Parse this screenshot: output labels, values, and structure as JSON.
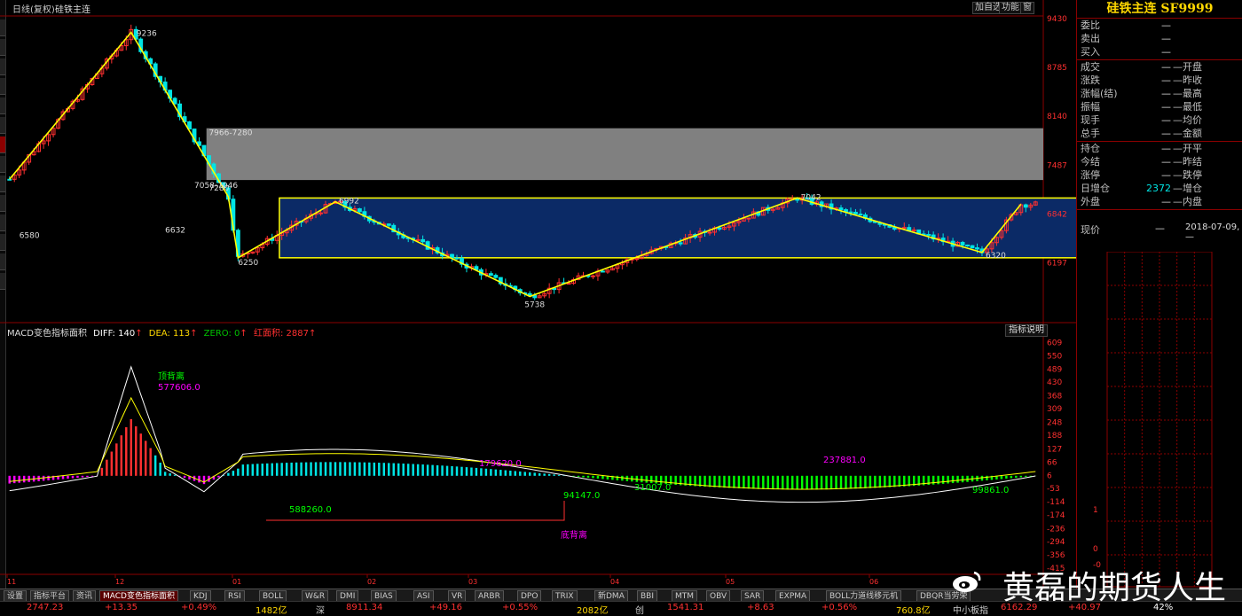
{
  "header": {
    "period": "日线(复权)",
    "name": "硅铁主连",
    "btn_add": "加自选",
    "btn_fn": "功能",
    "btn_win": "窗"
  },
  "chart_data": [
    {
      "type": "candlestick",
      "title": "硅铁主连 日线(复权)",
      "y_ticks": [
        9430,
        8785,
        8140,
        7487,
        6842,
        6197
      ],
      "x_ticks": [
        "11",
        "12",
        "01",
        "02",
        "03",
        "04",
        "05",
        "06"
      ],
      "ylim": [
        5485,
        9430
      ],
      "price_annotations": [
        "9236",
        "7966-7280",
        "7280",
        "7058-7046",
        "6632",
        "6580",
        "6992",
        "6250",
        "5738",
        "7042",
        "6320"
      ],
      "zigzag": [
        [
          0,
          7290
        ],
        [
          25,
          9236
        ],
        [
          45,
          7058
        ],
        [
          47,
          6250
        ],
        [
          67,
          6992
        ],
        [
          107,
          5738
        ],
        [
          162,
          7042
        ],
        [
          200,
          6320
        ],
        [
          208,
          6960
        ]
      ],
      "zones": [
        {
          "label": "7966-7280",
          "low": 7280,
          "high": 7966,
          "color": "#808080"
        },
        {
          "label": "box",
          "low": 6250,
          "high": 7042,
          "color": "#0b2a66"
        }
      ]
    },
    {
      "type": "line",
      "title": "MACD变色指标面积",
      "series": [
        {
          "name": "DIFF",
          "value": 140
        },
        {
          "name": "DEA",
          "value": 113
        },
        {
          "name": "ZERO",
          "value": 0
        },
        {
          "name": "红面积",
          "value": 2887
        }
      ],
      "y_ticks": [
        609,
        550,
        489,
        430,
        368,
        309,
        248,
        188,
        127,
        66,
        6,
        -53,
        -114,
        -174,
        -236,
        -294,
        -356,
        -415
      ],
      "ylim": [
        -440,
        640
      ],
      "annotations": [
        "顶背离",
        "577606.0",
        "588260.0",
        "179620.0",
        "94147.0",
        "31007.0",
        "237881.0",
        "99861.0",
        "底背离"
      ]
    }
  ],
  "macd_header": {
    "name": "MACD变色指标面积",
    "diff": "DIFF: 140",
    "dea": "DEA: 113",
    "zero": "ZERO: 0",
    "red": "红面积: 2887",
    "explain": "指标说明"
  },
  "quote": {
    "title": "硅铁主连 SF9999",
    "rows1": [
      {
        "l": "委比",
        "v": "—"
      },
      {
        "l": "卖出",
        "v": "—"
      },
      {
        "l": "买入",
        "v": "—"
      }
    ],
    "rows2": [
      {
        "l": "成交",
        "v": "—",
        "l2": "开盘",
        "v2": ""
      },
      {
        "l": "涨跌",
        "v": "—",
        "l2": "昨收",
        "v2": ""
      },
      {
        "l": "涨幅(结)",
        "v": "—",
        "l2": "最高",
        "v2": ""
      },
      {
        "l": "振幅",
        "v": "—",
        "l2": "最低",
        "v2": ""
      },
      {
        "l": "现手",
        "v": "—",
        "l2": "均价",
        "v2": ""
      },
      {
        "l": "总手",
        "v": "—",
        "l2": "金额",
        "v2": ""
      }
    ],
    "rows3": [
      {
        "l": "持仓",
        "v": "—",
        "l2": "开平",
        "v2": ""
      },
      {
        "l": "今结",
        "v": "—",
        "l2": "昨结",
        "v2": ""
      },
      {
        "l": "涨停",
        "v": "—",
        "l2": "跌停",
        "v2": ""
      },
      {
        "l": "日增仓",
        "v": "2372",
        "l2": "增仓",
        "v2": ""
      },
      {
        "l": "外盘",
        "v": "—",
        "l2": "内盘",
        "v2": ""
      }
    ],
    "price_label": "现价",
    "price_value": "—",
    "price_date": "2018-07-09,—",
    "grid_ticks": [
      "1",
      "0",
      "-0"
    ]
  },
  "tabs": [
    "设置",
    "指标平台",
    "资讯",
    "MACD变色指标面积",
    "KDJ",
    "RSI",
    "BOLL",
    "W&R",
    "DMI",
    "BIAS",
    "ASI",
    "VR",
    "ARBR",
    "DPO",
    "TRIX",
    "新DMA",
    "BBI",
    "MTM",
    "OBV",
    "SAR",
    "EXPMA",
    "BOLL力道线移元机",
    "DBQR当劳荣"
  ],
  "status": [
    {
      "t": "2747.23",
      "c": "#ff3030"
    },
    {
      "t": "+13.35",
      "c": "#ff3030"
    },
    {
      "t": "+0.49%",
      "c": "#ff3030"
    },
    {
      "t": "1482亿",
      "c": "#ffd800"
    },
    {
      "t": "深",
      "c": "#ccc"
    },
    {
      "t": "8911.34",
      "c": "#ff3030"
    },
    {
      "t": "+49.16",
      "c": "#ff3030"
    },
    {
      "t": "+0.55%",
      "c": "#ff3030"
    },
    {
      "t": "2082亿",
      "c": "#ffd800"
    },
    {
      "t": "创",
      "c": "#ccc"
    },
    {
      "t": "1541.31",
      "c": "#ff3030"
    },
    {
      "t": "+8.63",
      "c": "#ff3030"
    },
    {
      "t": "+0.56%",
      "c": "#ff3030"
    },
    {
      "t": "760.8亿",
      "c": "#ffd800"
    },
    {
      "t": "中小板指",
      "c": "#ccc"
    },
    {
      "t": "6162.29",
      "c": "#ff3030"
    },
    {
      "t": "+40.97",
      "c": "#ff3030"
    },
    {
      "t": "42%",
      "c": "#fff"
    }
  ],
  "watermark": "黄磊的期货人生",
  "colors": {
    "up": "#ff3030",
    "down": "#00e5e5",
    "grid": "#8b0000",
    "zig": "#ffff00",
    "diff": "#ffffff",
    "dea": "#ffff00"
  }
}
